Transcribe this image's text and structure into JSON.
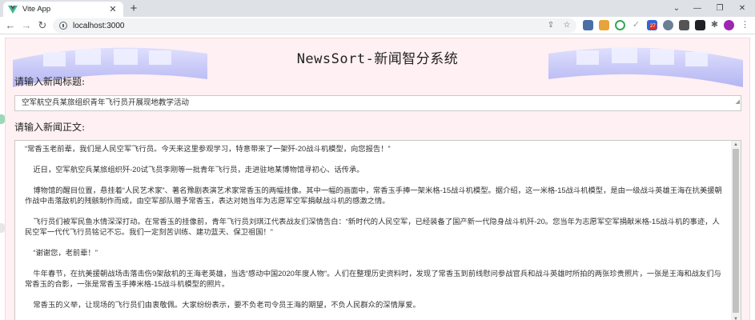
{
  "browser": {
    "tab_title": "Vite App",
    "tab_close": "✕",
    "new_tab": "+",
    "url": "localhost:3000",
    "controls": {
      "dropdown": "⌄",
      "minimize": "—",
      "restore": "❐",
      "close": "✕"
    },
    "nav": {
      "back": "←",
      "forward": "→",
      "reload": "↻"
    },
    "omnibox_icons": {
      "share": "⇪",
      "bookmark": "☆"
    },
    "extension_badge": "27",
    "accent_color": "#1a73e8"
  },
  "app": {
    "title": "NewsSort-新闻智分系统",
    "title_label": "请输入新闻标题:",
    "title_value": "空军航空兵某旅组织青年飞行员开展现地教学活动",
    "body_label": "请输入新闻正文:",
    "body_paragraphs": [
      "“常香玉老前辈，我们是人民空军飞行员。今天来这里参观学习，特意带来了一架歼-20战斗机模型，向您报告！”",
      "    近日，空军航空兵某旅组织歼-20试飞员李刚等一批青年飞行员，走进驻地某博物馆寻初心、话传承。",
      "    博物馆的醒目位置，悬挂着“人民艺术家”、著名豫剧表演艺术家常香玉的两幅挂像。其中一幅的画面中，常香玉手捧一架米格-15战斗机模型。据介绍，这一米格-15战斗机模型，是由一级战斗英雄王海在抗美援朝作战中击落敌机的残骸制作而成，由空军部队赠予常香玉，表达对她当年为志愿军空军捐献战斗机的感激之情。",
      "    飞行员们被军民鱼水情深深打动。在常香玉的挂像前，青年飞行员刘琪江代表战友们深情告白：“新时代的人民空军，已经装备了国产新一代隐身战斗机歼-20。您当年为志愿军空军捐献米格-15战斗机的事迹，人民空军一代代飞行员铭记不忘。我们一定刻苦训练、建功蓝天、保卫祖国！”",
      "    “谢谢您，老前辈！”",
      "    牛年春节，在抗美援朝战场击落击伤9架敌机的王海老英雄，当选“感动中国2020年度人物”。人们在整理历史资料时，发现了常香玉到前线慰问参战官兵和战斗英雄时所拍的两张珍贵照片，一张是王海和战友们与常香玉的合影，一张是常香玉手捧米格-15战斗机模型的照片。",
      "    常香玉的义举，让现场的飞行员们由衷敬佩。大家纷纷表示，要不负老司令员王海的期望，不负人民群众的深情厚爱。"
    ],
    "panel_color": "#fff0f3"
  }
}
